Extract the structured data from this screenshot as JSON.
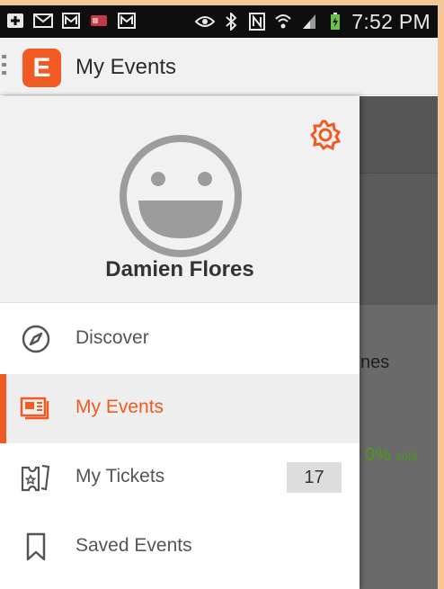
{
  "status_bar": {
    "time": "7:52 PM",
    "left_icons": [
      "add-icon",
      "mail-icon",
      "gmail-icon",
      "card-icon",
      "gmail-icon"
    ],
    "right_icons": [
      "eye-icon",
      "bluetooth-icon",
      "nfc-icon",
      "wifi-icon",
      "signal-icon",
      "battery-charging-icon"
    ]
  },
  "app_bar": {
    "logo_letter": "E",
    "title": "My Events",
    "accent_color": "#f15a23"
  },
  "drawer": {
    "profile": {
      "name": "Damien Flores"
    },
    "nav_items": [
      {
        "label": "Discover",
        "icon": "compass-icon",
        "active": false
      },
      {
        "label": "My Events",
        "icon": "ticket-card-icon",
        "active": true
      },
      {
        "label": "My Tickets",
        "icon": "tickets-icon",
        "active": false,
        "badge": "17"
      },
      {
        "label": "Saved Events",
        "icon": "bookmark-icon",
        "active": false
      }
    ]
  },
  "background_content": {
    "partial_text": "nes",
    "percent": "0%",
    "percent_suffix": "sold",
    "percent_color": "#4a9a1c"
  }
}
